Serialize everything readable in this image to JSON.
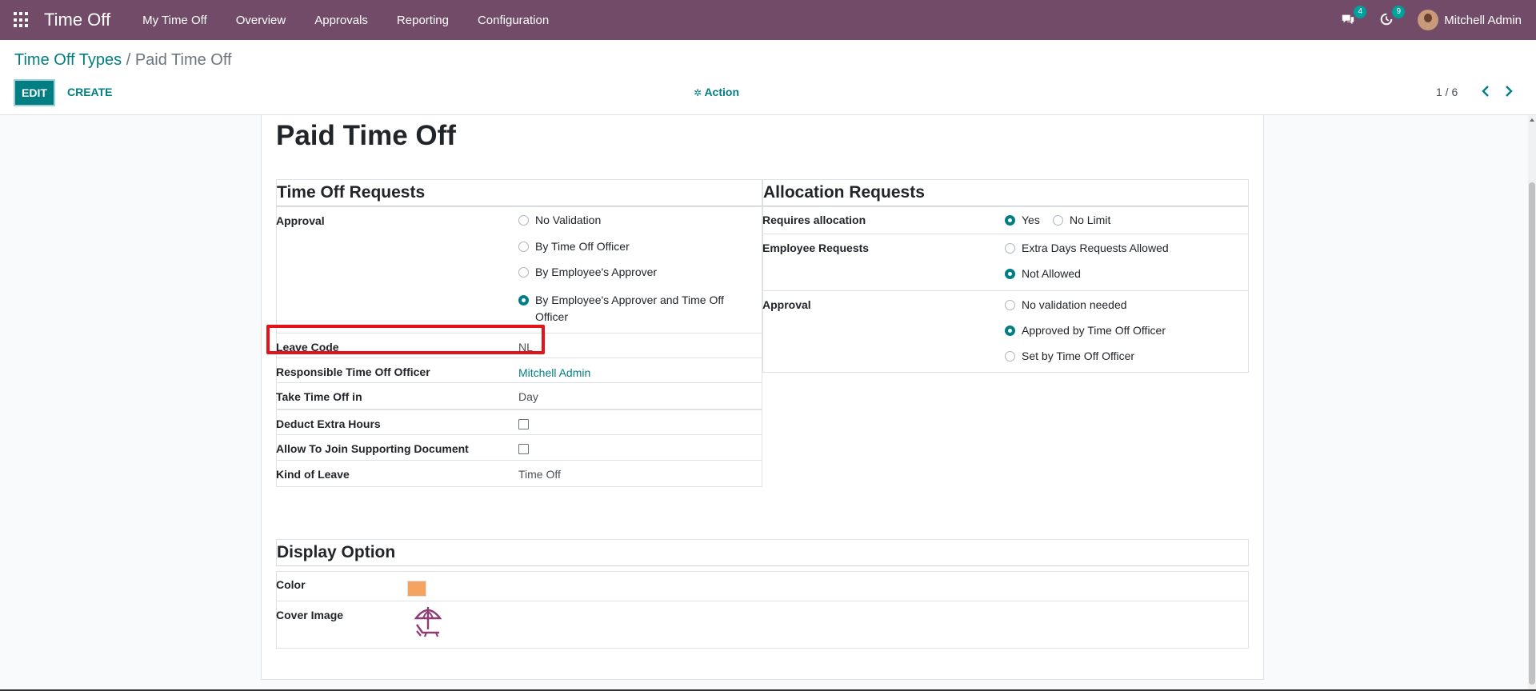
{
  "nav": {
    "app_name": "Time Off",
    "menu": [
      "My Time Off",
      "Overview",
      "Approvals",
      "Reporting",
      "Configuration"
    ],
    "messages_badge": "4",
    "activities_badge": "9",
    "user_name": "Mitchell Admin"
  },
  "breadcrumb": {
    "parent": "Time Off Types",
    "separator": "/",
    "current": "Paid Time Off"
  },
  "toolbar": {
    "edit_label": "EDIT",
    "create_label": "CREATE",
    "action_label": "Action",
    "pager": "1 / 6"
  },
  "record": {
    "title": "Paid Time Off"
  },
  "time_off_requests": {
    "title": "Time Off Requests",
    "approval_label": "Approval",
    "approval_options": [
      "No Validation",
      "By Time Off Officer",
      "By Employee's Approver",
      "By Employee's Approver and Time Off Officer"
    ],
    "approval_selected": 3,
    "leave_code_label": "Leave Code",
    "leave_code_value": "NL",
    "responsible_label": "Responsible Time Off Officer",
    "responsible_value": "Mitchell Admin",
    "take_in_label": "Take Time Off in",
    "take_in_value": "Day",
    "deduct_label": "Deduct Extra Hours",
    "deduct_checked": false,
    "allow_doc_label": "Allow To Join Supporting Document",
    "allow_doc_checked": false,
    "kind_label": "Kind of Leave",
    "kind_value": "Time Off"
  },
  "allocation_requests": {
    "title": "Allocation Requests",
    "requires_label": "Requires allocation",
    "requires_options": [
      "Yes",
      "No Limit"
    ],
    "requires_selected": 0,
    "employee_label": "Employee Requests",
    "employee_options": [
      "Extra Days Requests Allowed",
      "Not Allowed"
    ],
    "employee_selected": 1,
    "approval_label": "Approval",
    "approval_options": [
      "No validation needed",
      "Approved by Time Off Officer",
      "Set by Time Off Officer"
    ],
    "approval_selected": 1
  },
  "display_option": {
    "title": "Display Option",
    "color_label": "Color",
    "color_value": "#f4a460",
    "cover_label": "Cover Image",
    "cover_icon": "beach-umbrella-icon"
  }
}
